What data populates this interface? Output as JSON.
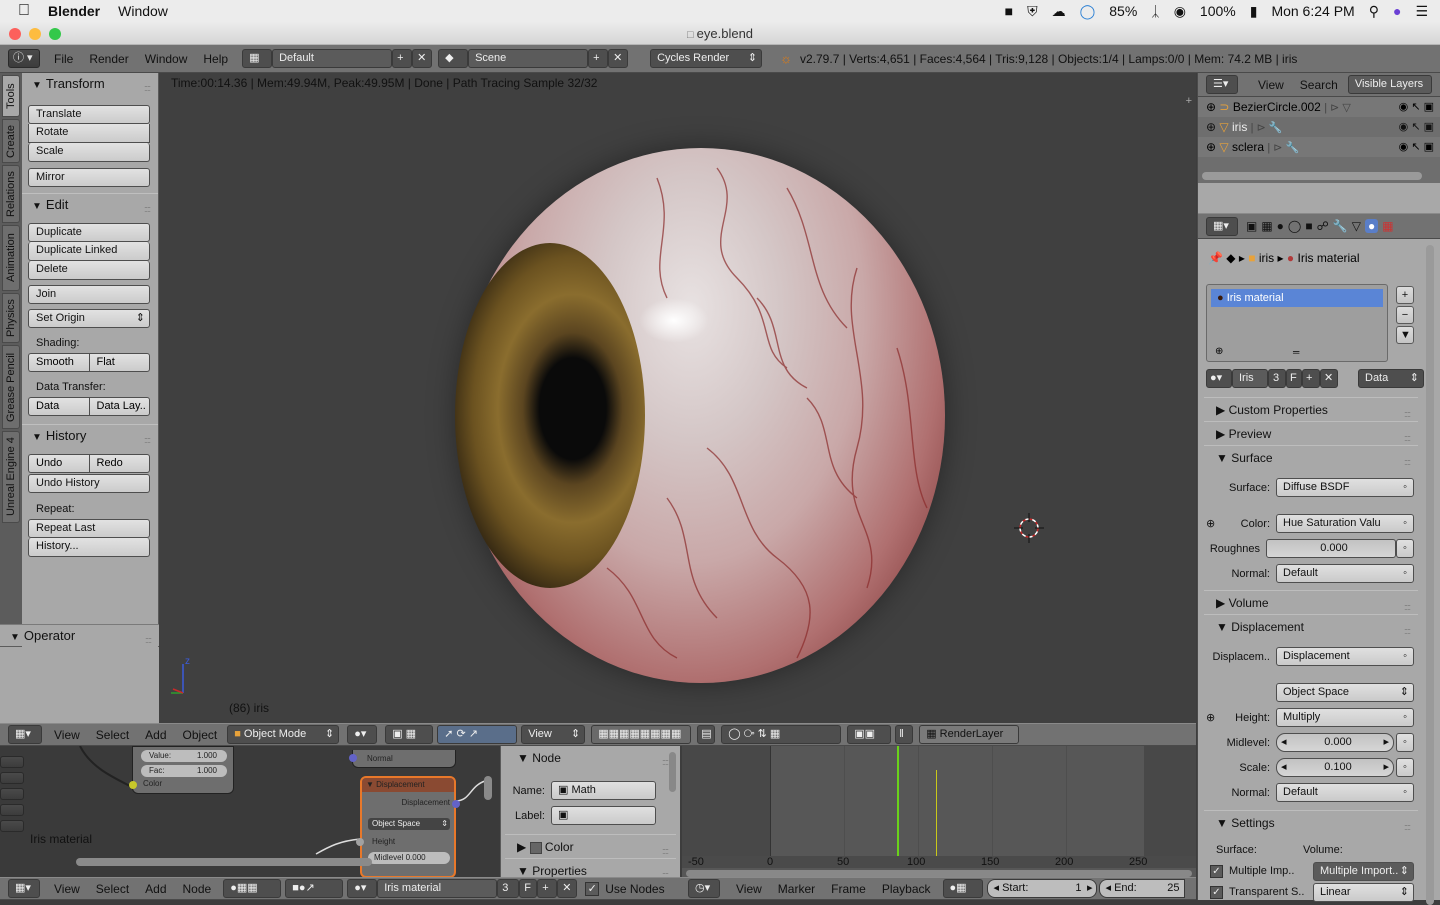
{
  "macos_menubar": {
    "apple": "",
    "app": "Blender",
    "menu": "Window",
    "battery_pct": "85%",
    "battery2": "100%",
    "clock": "Mon 6:24 PM"
  },
  "window": {
    "title": "eye.blend"
  },
  "info_header": {
    "menus": [
      "File",
      "Render",
      "Window",
      "Help"
    ],
    "layout": "Default",
    "scene": "Scene",
    "engine": "Cycles Render",
    "stats": "v2.79.7 | Verts:4,651 | Faces:4,564 | Tris:9,128 | Objects:1/4 | Lamps:0/0 | Mem: 74.2 MB | iris"
  },
  "tool_tabs": [
    "Tools",
    "Create",
    "Relations",
    "Animation",
    "Physics",
    "Grease Pencil",
    "Unreal Engine 4"
  ],
  "tool_shelf": {
    "transform_title": "Transform",
    "translate": "Translate",
    "rotate": "Rotate",
    "scale": "Scale",
    "mirror": "Mirror",
    "edit_title": "Edit",
    "duplicate": "Duplicate",
    "duplicate_linked": "Duplicate Linked",
    "delete": "Delete",
    "join": "Join",
    "set_origin": "Set Origin",
    "shading_label": "Shading:",
    "smooth": "Smooth",
    "flat": "Flat",
    "data_transfer_label": "Data Transfer:",
    "data": "Data",
    "data_layers": "Data Lay..",
    "history_title": "History",
    "undo": "Undo",
    "redo": "Redo",
    "undo_history": "Undo History",
    "repeat_label": "Repeat:",
    "repeat_last": "Repeat Last",
    "history_dots": "History...",
    "operator_title": "Operator"
  },
  "viewport": {
    "status": "Time:00:14.36 | Mem:49.94M, Peak:49.95M | Done | Path Tracing Sample 32/32",
    "object_label": "(86) iris",
    "axis_z": "z"
  },
  "view3d_header": {
    "view": "View",
    "select": "Select",
    "add": "Add",
    "object": "Object",
    "mode": "Object Mode",
    "transform_orientation": "View",
    "render_layer": "RenderLayer"
  },
  "node_editor": {
    "value_label": "Value:",
    "value": "1.000",
    "fac_label": "Fac:",
    "fac": "1.000",
    "color_label": "Color",
    "normal_label": "Normal",
    "displacement_node": "Displacement",
    "displacement_out": "Displacement",
    "space": "Object Space",
    "height_label": "Height",
    "midlevel_label": "Midlevel",
    "midlevel": "0.000",
    "material_label": "Iris material"
  },
  "node_props": {
    "node_title": "Node",
    "name_label": "Name:",
    "name_value": "Math",
    "label_label": "Label:",
    "color_title": "Color",
    "properties_title": "Properties"
  },
  "timeline": {
    "ticks": [
      "-50",
      "0",
      "50",
      "100",
      "150",
      "200",
      "250"
    ]
  },
  "node_footer": {
    "view": "View",
    "select": "Select",
    "add": "Add",
    "node": "Node",
    "material": "Iris material",
    "users": "3",
    "fake": "F",
    "use_nodes": "Use Nodes"
  },
  "timeline_footer": {
    "view": "View",
    "marker": "Marker",
    "frame": "Frame",
    "playback": "Playback",
    "start_label": "Start:",
    "start": "1",
    "end_label": "End:",
    "end": "25"
  },
  "outliner": {
    "view": "View",
    "search": "Search",
    "filter": "Visible Layers",
    "items": [
      {
        "name": "BezierCircle.002"
      },
      {
        "name": "iris"
      },
      {
        "name": "sclera"
      }
    ]
  },
  "properties": {
    "breadcrumb_obj": "iris",
    "breadcrumb_mat": "Iris material",
    "slot_name": "Iris material",
    "mat_name": "Iris",
    "mat_users": "3",
    "mat_fake": "F",
    "link": "Data",
    "sections": {
      "custom_props": "Custom Properties",
      "preview": "Preview",
      "surface": "Surface",
      "volume": "Volume",
      "displacement": "Displacement",
      "settings": "Settings"
    },
    "surface": {
      "surface_label": "Surface:",
      "surface_value": "Diffuse BSDF",
      "color_label": "Color:",
      "color_value": "Hue Saturation Valu",
      "roughness_label": "Roughnes",
      "roughness_value": "0.000",
      "normal_label": "Normal:",
      "normal_value": "Default"
    },
    "displacement": {
      "disp_label": "Displacem..",
      "disp_value": "Displacement",
      "space_value": "Object Space",
      "height_label": "Height:",
      "height_value": "Multiply",
      "midlevel_label": "Midlevel:",
      "midlevel_value": "0.000",
      "scale_label": "Scale:",
      "scale_value": "0.100",
      "normal_label": "Normal:",
      "normal_value": "Default"
    },
    "settings": {
      "surface_label": "Surface:",
      "volume_label": "Volume:",
      "multiple_imp": "Multiple Imp..",
      "multiple_import": "Multiple Import..",
      "transparent": "Transparent S..",
      "linear": "Linear"
    }
  }
}
